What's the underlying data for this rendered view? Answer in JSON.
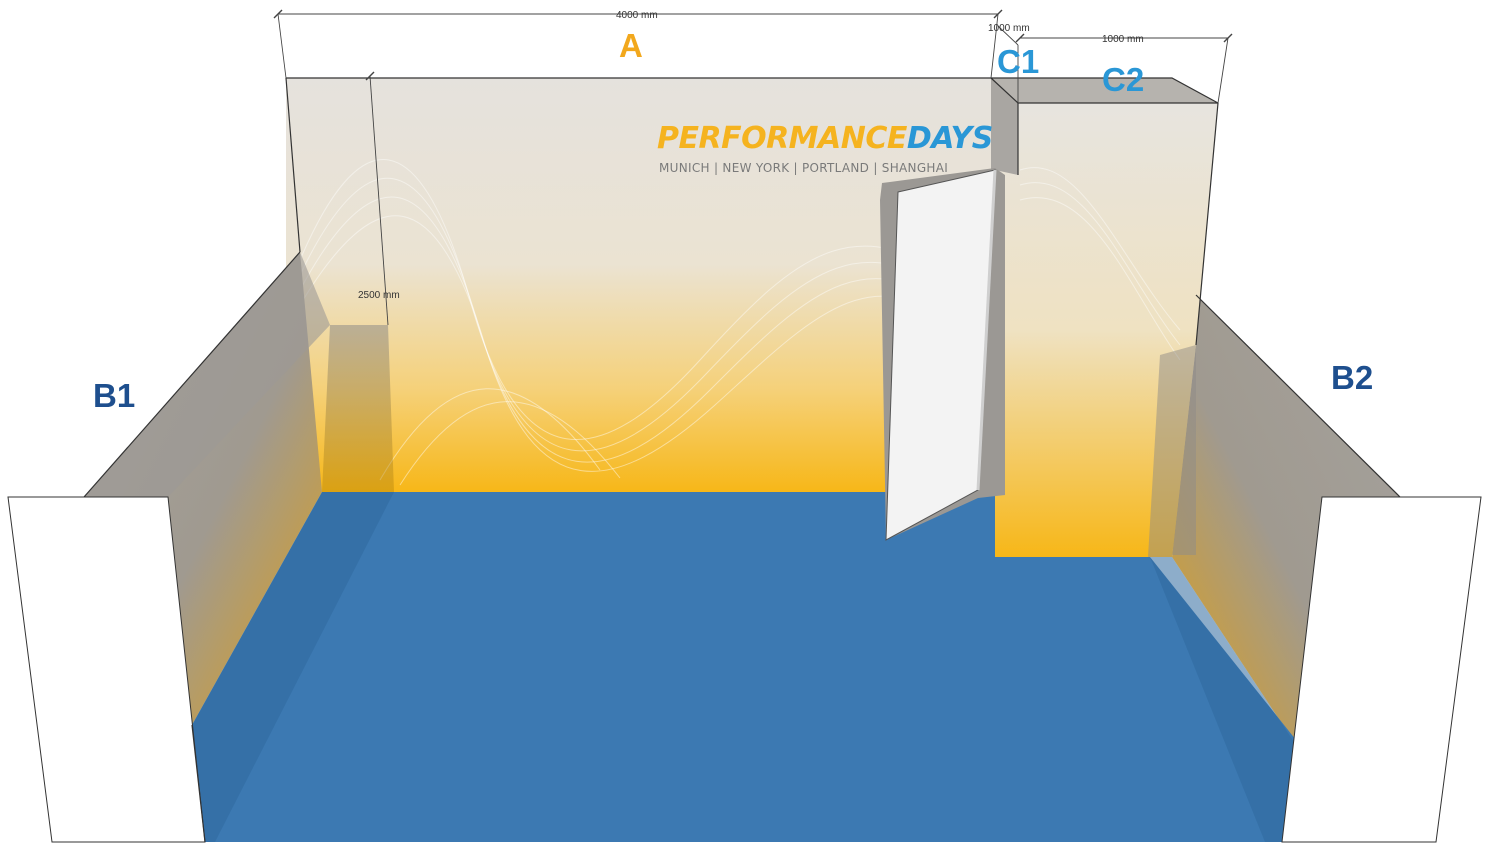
{
  "dimensions": {
    "width_a": "4000 mm",
    "width_c1": "1000 mm",
    "width_c2": "1000 mm",
    "height_a": "2500 mm"
  },
  "logo": {
    "brand_part1": "PERFORMANCE",
    "brand_part2": "DAYS",
    "cities": "MUNICH | NEW YORK | PORTLAND | SHANGHAI",
    "color_part1": "#f5b31f",
    "color_part2": "#2a97d6"
  },
  "labels": {
    "a": "A",
    "b1": "B1",
    "b2": "B2",
    "c1": "C1",
    "c2": "C2"
  },
  "colors": {
    "label_a": "#f2a81d",
    "label_b": "#1e4f8e",
    "label_c": "#2a97d6",
    "floor": "#3c79b2",
    "wall_top": "#e6e3de",
    "wall_bottom": "#f7b81a",
    "side_wall": "#9f9c98"
  }
}
